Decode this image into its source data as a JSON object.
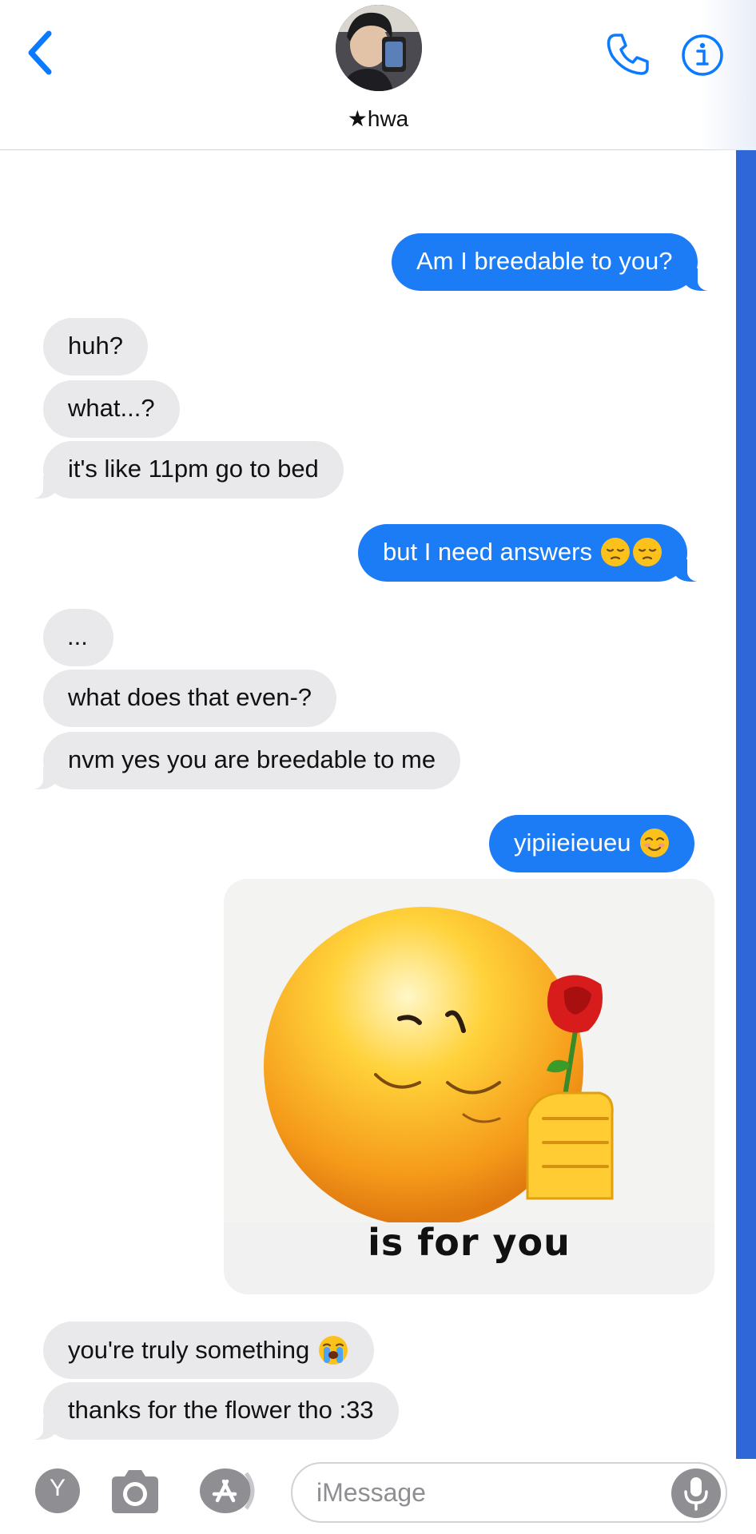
{
  "header": {
    "contact_name": "★hwa"
  },
  "messages": [
    {
      "side": "sent",
      "text": "Am I breedable to you?"
    },
    {
      "side": "received",
      "text": "huh?"
    },
    {
      "side": "received",
      "text": "what...?"
    },
    {
      "side": "received",
      "text": "it's like 11pm go to bed"
    },
    {
      "side": "sent",
      "text": "but I need answers",
      "emoji": [
        "pensive-face",
        "pensive-face"
      ]
    },
    {
      "side": "received",
      "text": "..."
    },
    {
      "side": "received",
      "text": "what does that even-?"
    },
    {
      "side": "received",
      "text": "nvm yes you are breedable to me"
    },
    {
      "side": "sent",
      "text": "yipiieieueu",
      "emoji": [
        "smiling-face"
      ]
    },
    {
      "side": "sent",
      "type": "image",
      "caption": "is for you",
      "image_desc": "smiling-emoji-holding-rose"
    },
    {
      "side": "received",
      "text": "you're truly something",
      "emoji": [
        "loudly-crying-face"
      ]
    },
    {
      "side": "received",
      "text": "thanks for the flower tho :33"
    }
  ],
  "composer": {
    "placeholder": "iMessage",
    "app_icon_letter": "Y"
  },
  "colors": {
    "sent_bubble": "#1b7cf5",
    "received_bubble": "#e9e9eb",
    "accent": "#0a7aff",
    "edge_strip": "#2f67d8"
  }
}
